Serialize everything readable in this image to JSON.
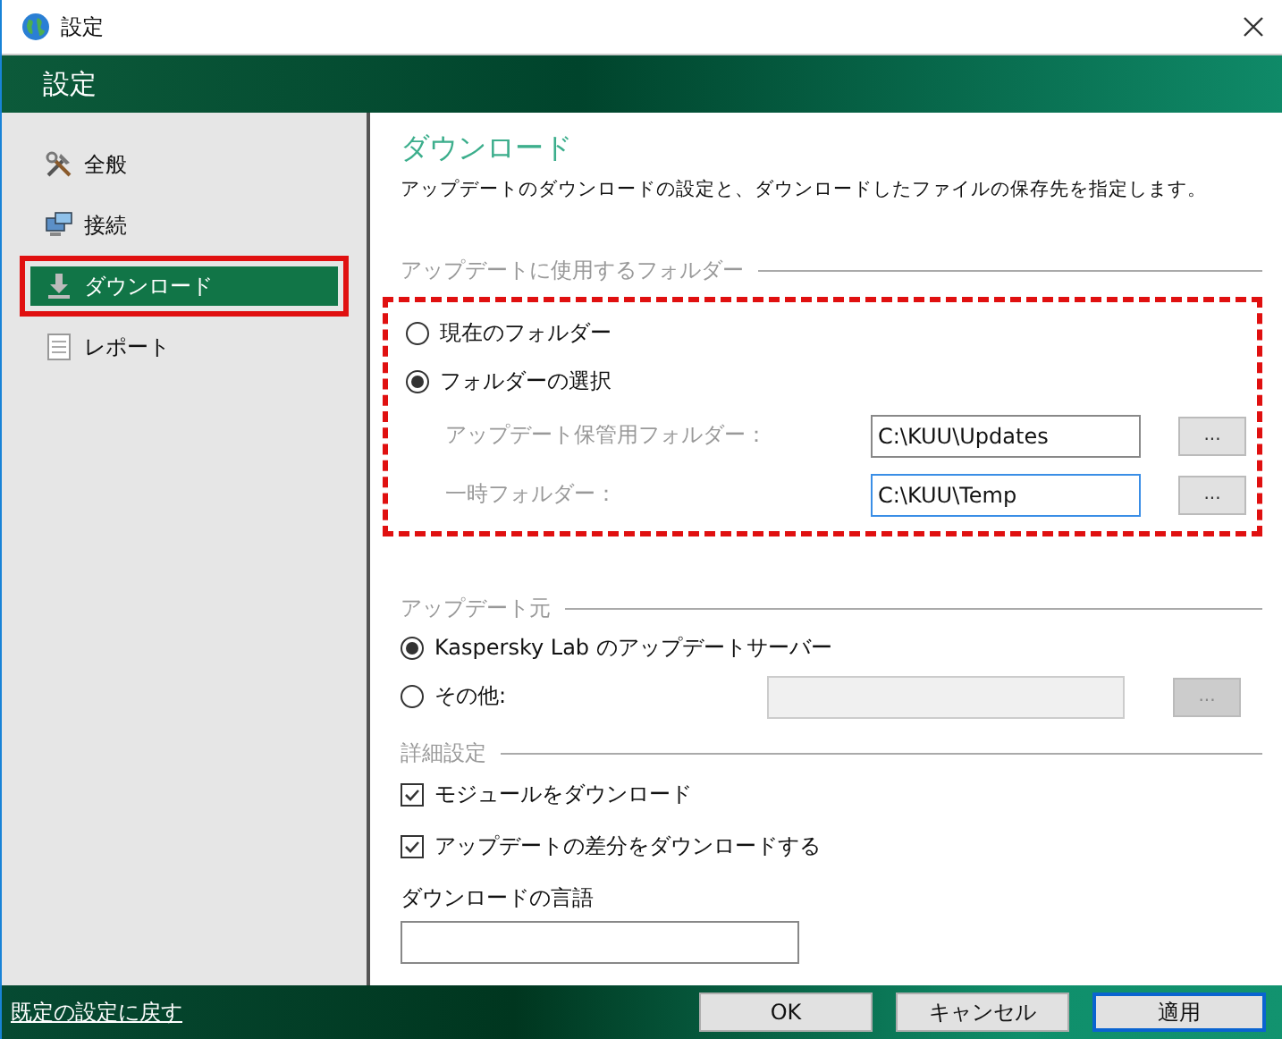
{
  "window": {
    "title": "設定"
  },
  "header": {
    "title": "設定"
  },
  "sidebar": {
    "items": [
      {
        "label": "全般",
        "selected": false,
        "highlighted": false
      },
      {
        "label": "接続",
        "selected": false,
        "highlighted": false
      },
      {
        "label": "ダウンロード",
        "selected": true,
        "highlighted": true
      },
      {
        "label": "レポート",
        "selected": false,
        "highlighted": false
      }
    ]
  },
  "page": {
    "title": "ダウンロード",
    "description": "アップデートのダウンロードの設定と、ダウンロードしたファイルの保存先を指定します。"
  },
  "folder_section": {
    "title": "アップデートに使用するフォルダー",
    "highlighted": true,
    "options": [
      {
        "label": "現在のフォルダー",
        "selected": false
      },
      {
        "label": "フォルダーの選択",
        "selected": true
      }
    ],
    "fields": [
      {
        "label": "アップデート保管用フォルダー：",
        "value": "C:\\KUU\\Updates",
        "focused": false,
        "button": "..."
      },
      {
        "label": "一時フォルダー：",
        "value": "C:\\KUU\\Temp",
        "focused": true,
        "button": "..."
      }
    ]
  },
  "source_section": {
    "title": "アップデート元",
    "options": [
      {
        "label": "Kaspersky Lab のアップデートサーバー",
        "selected": true
      },
      {
        "label": "その他:",
        "selected": false,
        "field": {
          "disabled": true,
          "button": "..."
        }
      }
    ]
  },
  "advanced_section": {
    "title": "詳細設定",
    "checkboxes": [
      {
        "label": "モジュールをダウンロード",
        "checked": true
      },
      {
        "label": "アップデートの差分をダウンロードする",
        "checked": true
      }
    ],
    "language": {
      "label": "ダウンロードの言語"
    }
  },
  "footer": {
    "link": "既定の設定に戻す",
    "buttons": [
      {
        "label": "OK",
        "focused": false
      },
      {
        "label": "キャンセル",
        "focused": false
      },
      {
        "label": "適用",
        "focused": true
      }
    ]
  }
}
